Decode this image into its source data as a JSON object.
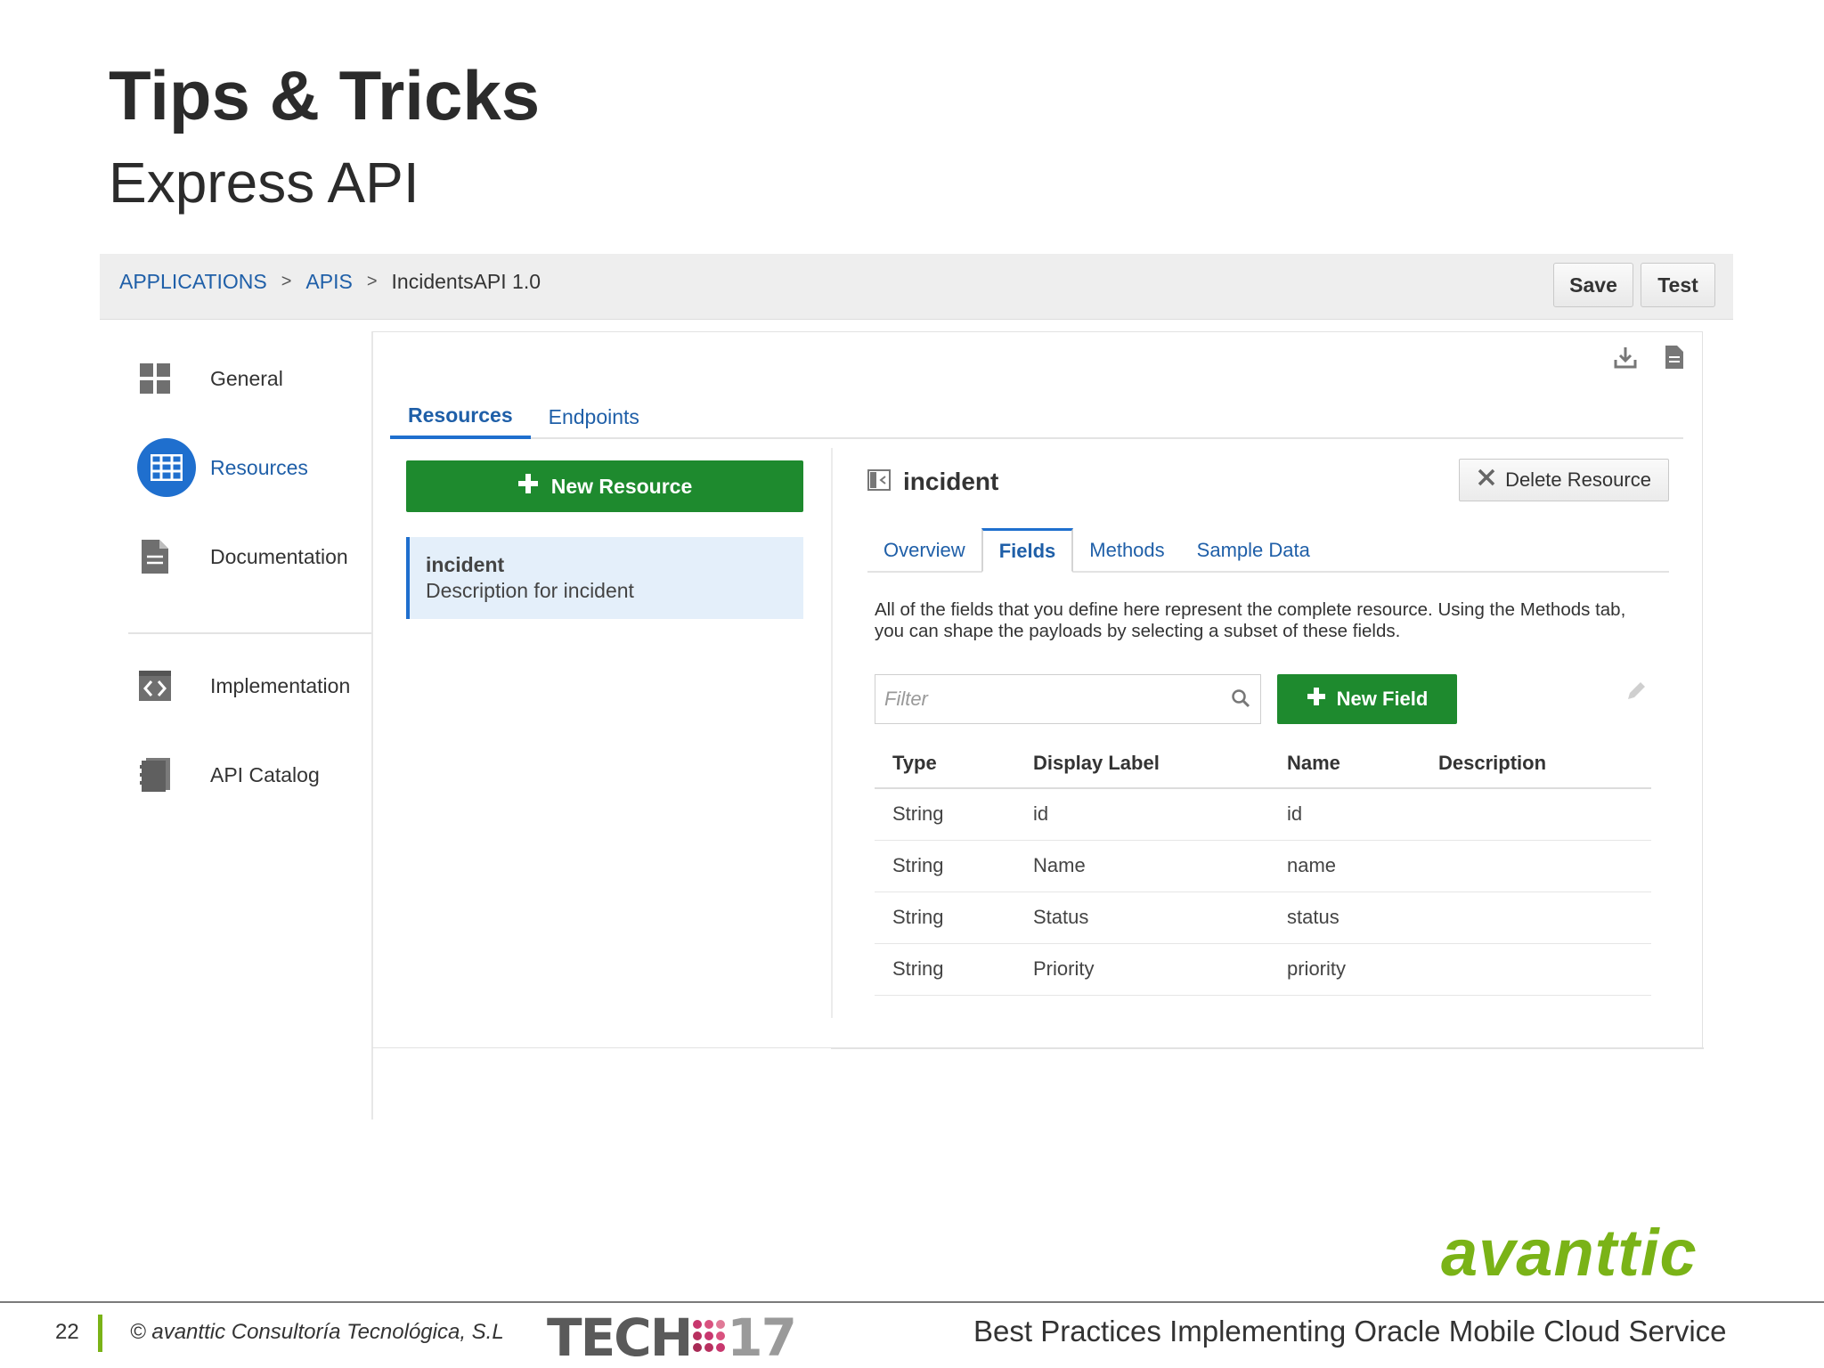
{
  "slide": {
    "title": "Tips & Tricks",
    "subtitle": "Express API"
  },
  "breadcrumb": {
    "items": [
      "APPLICATIONS",
      "APIS"
    ],
    "separator": ">",
    "current": "IncidentsAPI  1.0"
  },
  "toolbar": {
    "save_label": "Save",
    "test_label": "Test"
  },
  "leftnav": {
    "items": [
      {
        "label": "General",
        "icon": "grid-icon"
      },
      {
        "label": "Resources",
        "icon": "table-icon",
        "active": true
      },
      {
        "label": "Documentation",
        "icon": "document-icon"
      },
      {
        "label": "Implementation",
        "icon": "code-icon"
      },
      {
        "label": "API Catalog",
        "icon": "catalog-icon"
      }
    ]
  },
  "main": {
    "tabs": [
      {
        "label": "Resources",
        "active": true
      },
      {
        "label": "Endpoints"
      }
    ],
    "new_resource_label": "New Resource",
    "resource_item": {
      "name": "incident",
      "description": "Description for incident"
    }
  },
  "detail": {
    "title": "incident",
    "delete_label": "Delete Resource",
    "subtabs": [
      {
        "label": "Overview"
      },
      {
        "label": "Fields",
        "active": true
      },
      {
        "label": "Methods"
      },
      {
        "label": "Sample Data"
      }
    ],
    "description": "All of the fields that you define here represent the complete resource. Using the Methods tab, you can shape the payloads by selecting a subset of these fields.",
    "filter_placeholder": "Filter",
    "new_field_label": "New Field",
    "table": {
      "headers": [
        "Type",
        "Display Label",
        "Name",
        "Description"
      ],
      "rows": [
        [
          "String",
          "id",
          "id",
          ""
        ],
        [
          "String",
          "Name",
          "name",
          ""
        ],
        [
          "String",
          "Status",
          "status",
          ""
        ],
        [
          "String",
          "Priority",
          "priority",
          ""
        ]
      ]
    }
  },
  "footer": {
    "page_number": "22",
    "copyright": "© avanttic Consultoría Tecnológica, S.L",
    "tech_logo": "TECH",
    "tech_year": "17",
    "title": "Best Practices Implementing Oracle Mobile Cloud Service",
    "brand_logo": "avanttic"
  },
  "colors": {
    "accent_blue": "#1f6fce",
    "link_blue": "#1f5fa8",
    "button_green": "#1e8a2e",
    "brand_green": "#7ab317"
  }
}
